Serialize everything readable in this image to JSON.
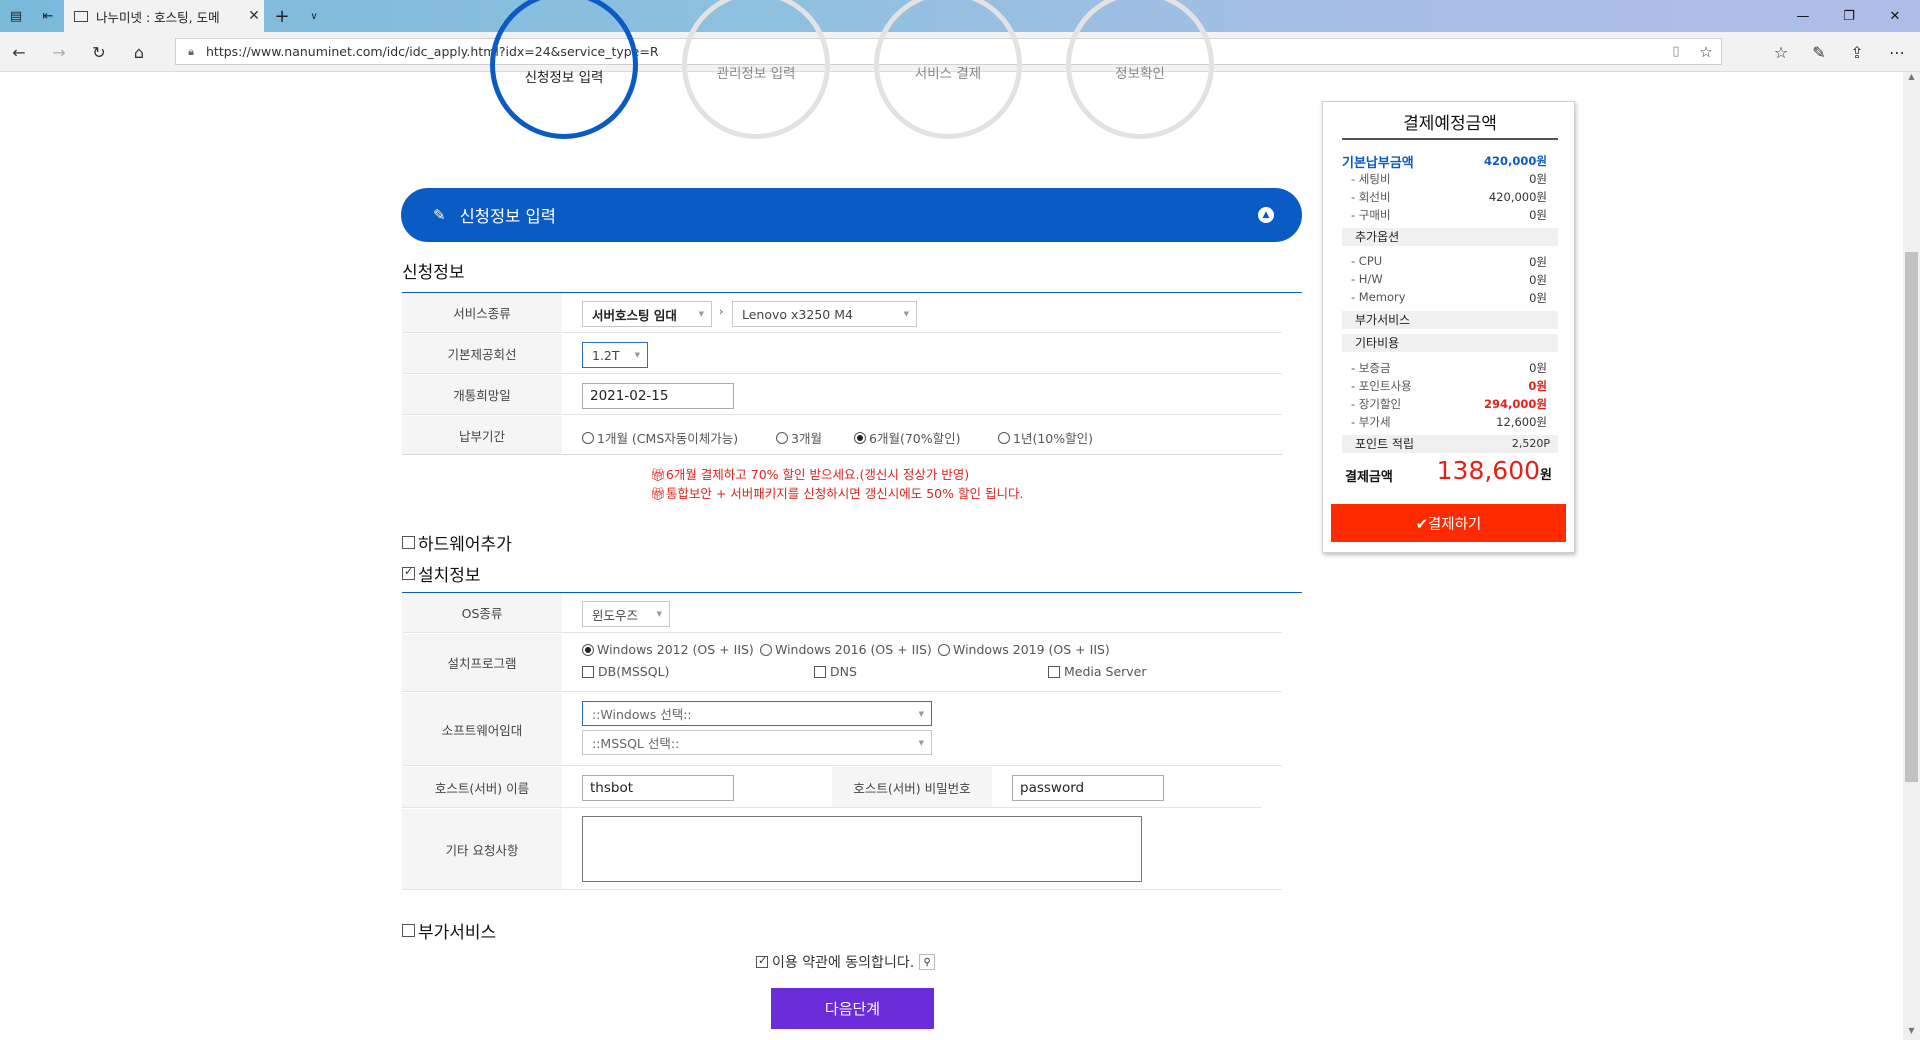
{
  "browser": {
    "tab_title": "나누미넷 : 호스팅, 도메",
    "url": "https://www.nanuminet.com/idc/idc_apply.html?idx=24&service_type=R"
  },
  "steps": [
    "신청정보 입력",
    "관리정보 입력",
    "서비스 결제",
    "정보확인"
  ],
  "section_bar": {
    "title": "신청정보 입력"
  },
  "apply_info": {
    "heading": "신청정보",
    "service_type": {
      "label": "서비스종류",
      "category": "서버호스팅 임대",
      "model": "Lenovo x3250 M4"
    },
    "line": {
      "label": "기본제공회선",
      "value": "1.2T"
    },
    "open_date": {
      "label": "개통희망일",
      "value": "2021-02-15"
    },
    "payment_period": {
      "label": "납부기간",
      "options": [
        "1개월 (CMS자동이체가능)",
        "3개월",
        "6개월(70%할인)",
        "1년(10%할인)"
      ],
      "selected": 2
    },
    "notices": [
      "6개월 결제하고 70% 할인 받으세요.(갱신시 정상가 반영)",
      "통합보안 + 서버패키지를 신청하시면 갱신시에도 50% 할인 됩니다."
    ]
  },
  "hardware_add": {
    "label": "하드웨어추가",
    "checked": false
  },
  "install_info": {
    "label": "설치정보",
    "checked": true,
    "os": {
      "label": "OS종류",
      "value": "윈도우즈"
    },
    "programs": {
      "label": "설치프로그램",
      "radios": [
        "Windows 2012 (OS + IIS)",
        "Windows 2016 (OS + IIS)",
        "Windows 2019 (OS + IIS)"
      ],
      "selected": 0,
      "checkboxes": [
        "DB(MSSQL)",
        "DNS",
        "Media Server"
      ]
    },
    "software_rent": {
      "label": "소프트웨어임대",
      "windows": "::Windows 선택::",
      "mssql": "::MSSQL 선택::"
    },
    "host_name": {
      "label": "호스트(서버) 이름",
      "value": "thsbot"
    },
    "host_password": {
      "label": "호스트(서버) 비밀번호",
      "value": "password"
    },
    "request": {
      "label": "기타 요청사항"
    }
  },
  "addon_service": {
    "label": "부가서비스",
    "checked": false
  },
  "agree": {
    "label": "이용 약관에 동의합니다.",
    "checked": true
  },
  "next_button": "다음단계",
  "summary": {
    "title": "결제예정금액",
    "basic": {
      "label": "기본납부금액",
      "value": "420,000원"
    },
    "basic_items": [
      {
        "label": "- 세팅비",
        "value": "0원"
      },
      {
        "label": "- 회선비",
        "value": "420,000원"
      },
      {
        "label": "- 구매비",
        "value": "0원"
      }
    ],
    "option_group": "추가옵션",
    "option_items": [
      {
        "label": "- CPU",
        "value": "0원"
      },
      {
        "label": "- H/W",
        "value": "0원"
      },
      {
        "label": "- Memory",
        "value": "0원"
      }
    ],
    "addon_group": "부가서비스",
    "etc_group": "기타비용",
    "etc_items": [
      {
        "label": "- 보증금",
        "value": "0원"
      },
      {
        "label": "- 포인트사용",
        "value": "0원"
      },
      {
        "label": "- 장기할인",
        "value": "294,000원"
      },
      {
        "label": "- 부가세",
        "value": "12,600원"
      }
    ],
    "points": {
      "label": "포인트 적립",
      "value": "2,520P"
    },
    "total": {
      "label": "결제금액",
      "amount": "138,600",
      "unit": "원"
    },
    "pay_button": "✔결제하기"
  },
  "colors": {
    "primary": "#0a5bc4",
    "red": "#e0241c",
    "pay": "#ff2a00",
    "next": "#6a2bd8"
  }
}
